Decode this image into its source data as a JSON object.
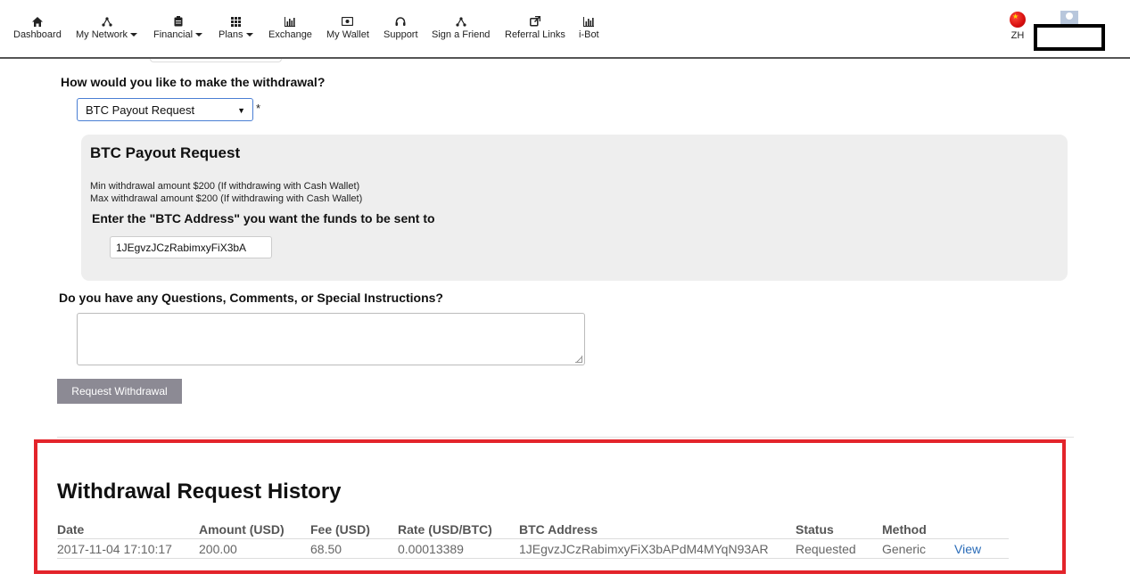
{
  "nav": {
    "items": [
      {
        "label": "Dashboard",
        "icon": "home-icon",
        "dropdown": false
      },
      {
        "label": "My Network",
        "icon": "network-icon",
        "dropdown": true
      },
      {
        "label": "Financial",
        "icon": "clipboard-icon",
        "dropdown": true
      },
      {
        "label": "Plans",
        "icon": "grid-icon",
        "dropdown": true
      },
      {
        "label": "Exchange",
        "icon": "bar-chart-icon",
        "dropdown": false
      },
      {
        "label": "My Wallet",
        "icon": "wallet-icon",
        "dropdown": false
      },
      {
        "label": "Support",
        "icon": "headset-icon",
        "dropdown": false
      },
      {
        "label": "Sign a Friend",
        "icon": "network-icon",
        "dropdown": false
      },
      {
        "label": "Referral Links",
        "icon": "external-link-icon",
        "dropdown": false
      },
      {
        "label": "i-Bot",
        "icon": "bar-chart-icon",
        "dropdown": false
      }
    ],
    "language": "ZH"
  },
  "form": {
    "method_question": "How would you like to make the withdrawal?",
    "method_selected": "BTC Payout Request",
    "required_mark": "*",
    "panel_title": "BTC Payout Request",
    "min_note": "Min withdrawal amount $200 (If withdrawing with Cash Wallet)",
    "max_note": "Max withdrawal amount $200 (If withdrawing with Cash Wallet)",
    "address_label": "Enter the \"BTC Address\" you want the funds to be sent to",
    "address_value": "1JEgvzJCzRabimxyFiX3bA",
    "comments_question": "Do you have any Questions, Comments, or Special Instructions?",
    "comments_value": "",
    "submit_label": "Request Withdrawal"
  },
  "history": {
    "title": "Withdrawal Request History",
    "columns": [
      "Date",
      "Amount (USD)",
      "Fee (USD)",
      "Rate (USD/BTC)",
      "BTC Address",
      "Status",
      "Method"
    ],
    "rows": [
      {
        "date": "2017-11-04 17:10:17",
        "amount": "200.00",
        "fee": "68.50",
        "rate": "0.00013389",
        "address": "1JEgvzJCzRabimxyFiX3bAPdM4MYqN93AR",
        "status": "Requested",
        "method": "Generic",
        "action": "View"
      }
    ]
  },
  "colors": {
    "highlight_border": "#e3242b",
    "button_bg": "#8c8a94",
    "link": "#2a6cb8",
    "panel_bg": "#eeeeee"
  }
}
